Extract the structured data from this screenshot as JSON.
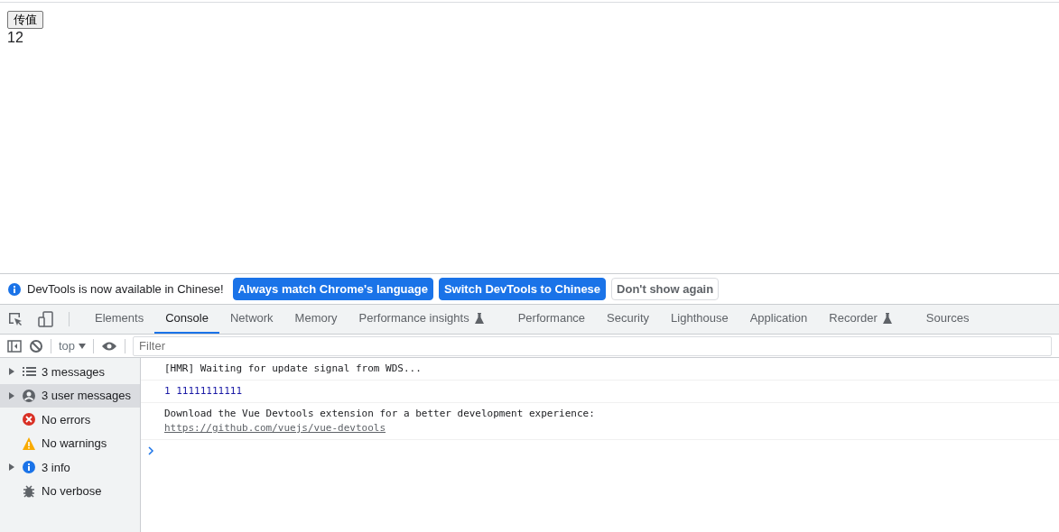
{
  "page": {
    "button": "传值",
    "output": "12"
  },
  "infobar": {
    "message": "DevTools is now available in Chinese!",
    "buttons": [
      {
        "label": "Always match Chrome's language",
        "kind": "primary"
      },
      {
        "label": "Switch DevTools to Chinese",
        "kind": "primary"
      },
      {
        "label": "Don't show again",
        "kind": "secondary"
      }
    ]
  },
  "tabs": [
    {
      "label": "Elements",
      "selected": false,
      "experimental": false
    },
    {
      "label": "Console",
      "selected": true,
      "experimental": false
    },
    {
      "label": "Network",
      "selected": false,
      "experimental": false
    },
    {
      "label": "Memory",
      "selected": false,
      "experimental": false
    },
    {
      "label": "Performance insights",
      "selected": false,
      "experimental": true
    },
    {
      "label": "Performance",
      "selected": false,
      "experimental": false
    },
    {
      "label": "Security",
      "selected": false,
      "experimental": false
    },
    {
      "label": "Lighthouse",
      "selected": false,
      "experimental": false
    },
    {
      "label": "Application",
      "selected": false,
      "experimental": false
    },
    {
      "label": "Recorder",
      "selected": false,
      "experimental": true
    },
    {
      "label": "Sources",
      "selected": false,
      "experimental": false
    }
  ],
  "toolbar": {
    "context": "top",
    "filter_placeholder": "Filter"
  },
  "sidebar": [
    {
      "label": "3 messages",
      "kind": "messages",
      "expandable": true,
      "selected": false
    },
    {
      "label": "3 user messages",
      "kind": "user",
      "expandable": true,
      "selected": true
    },
    {
      "label": "No errors",
      "kind": "errors",
      "expandable": false,
      "selected": false
    },
    {
      "label": "No warnings",
      "kind": "warnings",
      "expandable": false,
      "selected": false
    },
    {
      "label": "3 info",
      "kind": "info",
      "expandable": true,
      "selected": false
    },
    {
      "label": "No verbose",
      "kind": "verbose",
      "expandable": false,
      "selected": false
    }
  ],
  "console": [
    {
      "kind": "text",
      "text": "[HMR] Waiting for update signal from WDS..."
    },
    {
      "kind": "number",
      "text": "1 11111111111"
    },
    {
      "kind": "text",
      "text": "Download the Vue Devtools extension for a better development experience:",
      "link": "https://github.com/vuejs/vue-devtools"
    }
  ]
}
